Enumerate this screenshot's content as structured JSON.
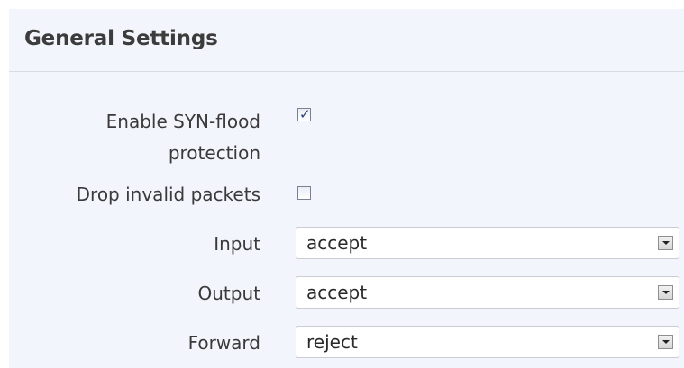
{
  "section": {
    "title": "General Settings"
  },
  "fields": {
    "syn_flood": {
      "label_line1": "Enable SYN-flood",
      "label_line2": "protection",
      "checked": true
    },
    "drop_invalid": {
      "label": "Drop invalid packets",
      "checked": false
    },
    "input": {
      "label": "Input",
      "value": "accept"
    },
    "output": {
      "label": "Output",
      "value": "accept"
    },
    "forward": {
      "label": "Forward",
      "value": "reject"
    }
  },
  "icons": {
    "checkmark": "✓",
    "dropdown": "chevron-down-icon"
  }
}
